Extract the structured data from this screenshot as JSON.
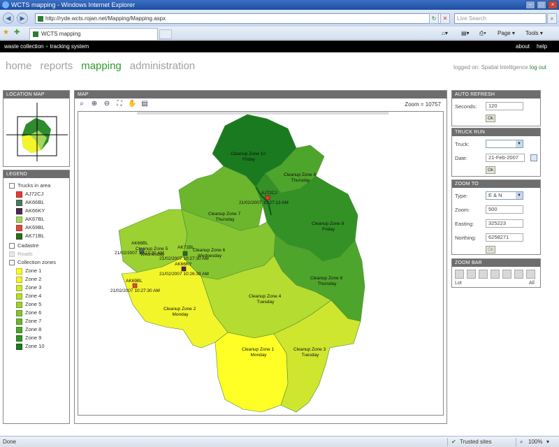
{
  "browser": {
    "title": "WCTS mapping - Windows Internet Explorer",
    "url": "http://ryde.wcts.rojan.net/Mapping/Mapping.aspx",
    "search_placeholder": "Live Search",
    "tab_label": "WCTS mapping",
    "page_menu": "Page",
    "tools_menu": "Tools",
    "status_left": "Done",
    "status_zone": "Trusted sites",
    "zoom_level": "100%"
  },
  "header": {
    "title_part1": "waste collection",
    "title_plus": "+",
    "title_part2": "tracking system",
    "about": "about",
    "help": "help"
  },
  "nav": {
    "items": [
      {
        "label": "home",
        "active": false
      },
      {
        "label": "reports",
        "active": false
      },
      {
        "label": "mapping",
        "active": true
      },
      {
        "label": "administration",
        "active": false
      }
    ],
    "logged_on_label": "logged on:",
    "logged_on_user": "Spatial Intelligence",
    "logout": "log out"
  },
  "location_map": {
    "heading": "LOCATION MAP"
  },
  "legend": {
    "heading": "LEGEND",
    "trucks_label": "Trucks in area",
    "trucks": [
      {
        "id": "AJ72CJ",
        "color": "#e53935"
      },
      {
        "id": "AK66BL",
        "color": "#4d7a5f"
      },
      {
        "id": "AK66KY",
        "color": "#4a2c4f"
      },
      {
        "id": "AK67BL",
        "color": "#a5d65a"
      },
      {
        "id": "AK69BL",
        "color": "#e04a3a"
      },
      {
        "id": "AK71BL",
        "color": "#2e6b1f"
      }
    ],
    "cadastre": "Cadastre",
    "roads": "Roads",
    "zones_label": "Collection zones",
    "zones": [
      {
        "name": "Zone 1",
        "color": "#ffff26"
      },
      {
        "name": "Zone 2",
        "color": "#f2f52a"
      },
      {
        "name": "Zone 3",
        "color": "#cfe62e"
      },
      {
        "name": "Zone 4",
        "color": "#b5dc30"
      },
      {
        "name": "Zone 5",
        "color": "#9bd132"
      },
      {
        "name": "Zone 6",
        "color": "#84c531"
      },
      {
        "name": "Zone 7",
        "color": "#6cb62e"
      },
      {
        "name": "Zone 8",
        "color": "#4ea52b"
      },
      {
        "name": "Zone 9",
        "color": "#339126"
      },
      {
        "name": "Zone 10",
        "color": "#1a7a1f"
      }
    ]
  },
  "map": {
    "heading": "MAP",
    "zoom_label": "Zoom = 10757",
    "zone_labels": [
      {
        "name": "Cleanup Zone 10",
        "day": "Friday"
      },
      {
        "name": "Cleanup Zone 8",
        "day": "Thursday"
      },
      {
        "name": "Cleanup Zone 7",
        "day": "Thursday"
      },
      {
        "name": "Cleanup Zone 9",
        "day": "Friday"
      },
      {
        "name": "Cleanup Zone 5",
        "day": "Wednesday"
      },
      {
        "name": "Cleanup Zone 6",
        "day": "Wednesday"
      },
      {
        "name": "Cleanup Zone 8",
        "day": "Thursday"
      },
      {
        "name": "Cleanup Zone 4",
        "day": "Tuesday"
      },
      {
        "name": "Cleanup Zone 2",
        "day": "Monday"
      },
      {
        "name": "Cleanup Zone 1",
        "day": "Monday"
      },
      {
        "name": "Cleanup Zone 3",
        "day": "Tuesday"
      }
    ],
    "truck_markers": [
      {
        "id": "AJ72CJ",
        "time": "21/02/2007 10:27:13 AM"
      },
      {
        "id": "AK66BL",
        "time": "21/02/2007 10:27:30 AM"
      },
      {
        "id": "AK71BL",
        "time": "21/02/2007 10:27:30 AM"
      },
      {
        "id": "AK66KY",
        "time": "21/02/2007 10:26:39 AM"
      },
      {
        "id": "AK69BL",
        "time": "21/02/2007 10:27:30 AM"
      }
    ]
  },
  "auto_refresh": {
    "heading": "AUTO REFRESH",
    "seconds_label": "Seconds:",
    "seconds_value": "120",
    "ok": "Ok"
  },
  "truck_run": {
    "heading": "TRUCK RUN",
    "truck_label": "Truck:",
    "truck_value": "",
    "date_label": "Date:",
    "date_value": "21-Feb-2007",
    "ok": "Ok"
  },
  "zoom_to": {
    "heading": "ZOOM TO",
    "type_label": "Type:",
    "type_value": "E & N",
    "zoom_label": "Zoom:",
    "zoom_value": "500",
    "easting_label": "Easting:",
    "easting_value": "325223",
    "northing_label": "Northing:",
    "northing_value": "6258271",
    "ok": "Ok"
  },
  "zoom_bar": {
    "heading": "ZOOM BAR",
    "lot": "Lot",
    "all": "All"
  }
}
